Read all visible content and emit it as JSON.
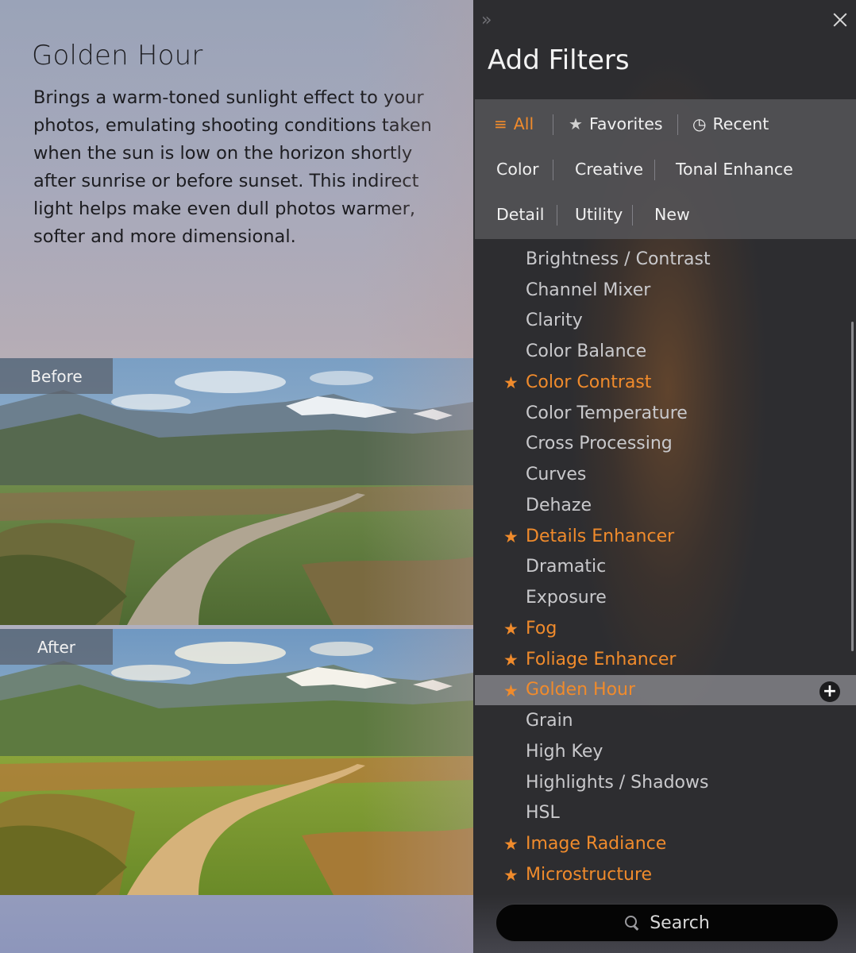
{
  "preview": {
    "title": "Golden Hour",
    "description": "Brings a warm-toned sunlight effect to your photos, emulating shooting conditions taken when the sun is low on the horizon shortly after sunrise or before sunset. This indirect light helps make even dull photos warmer, softer and more dimensional.",
    "before_label": "Before",
    "after_label": "After"
  },
  "panel": {
    "title": "Add Filters",
    "expand_icon": "double-chevron-right-icon",
    "close_icon": "close-icon",
    "categories": {
      "all": "All",
      "favorites": "Favorites",
      "recent": "Recent",
      "color": "Color",
      "creative": "Creative",
      "tonal_enhance": "Tonal Enhance",
      "detail": "Detail",
      "utility": "Utility",
      "new": "New"
    },
    "active_category": "All",
    "filters": [
      {
        "name": "Brightness / Contrast",
        "favorite": false
      },
      {
        "name": "Channel Mixer",
        "favorite": false
      },
      {
        "name": "Clarity",
        "favorite": false
      },
      {
        "name": "Color Balance",
        "favorite": false
      },
      {
        "name": "Color Contrast",
        "favorite": true
      },
      {
        "name": "Color Temperature",
        "favorite": false
      },
      {
        "name": "Cross Processing",
        "favorite": false
      },
      {
        "name": "Curves",
        "favorite": false
      },
      {
        "name": "Dehaze",
        "favorite": false
      },
      {
        "name": "Details Enhancer",
        "favorite": true
      },
      {
        "name": "Dramatic",
        "favorite": false
      },
      {
        "name": "Exposure",
        "favorite": false
      },
      {
        "name": "Fog",
        "favorite": true
      },
      {
        "name": "Foliage Enhancer",
        "favorite": true
      },
      {
        "name": "Golden Hour",
        "favorite": true,
        "selected": true
      },
      {
        "name": "Grain",
        "favorite": false
      },
      {
        "name": "High Key",
        "favorite": false
      },
      {
        "name": "Highlights / Shadows",
        "favorite": false
      },
      {
        "name": "HSL",
        "favorite": false
      },
      {
        "name": "Image Radiance",
        "favorite": true
      },
      {
        "name": "Microstructure",
        "favorite": true
      }
    ],
    "search_label": "Search"
  },
  "colors": {
    "accent": "#f08b2c",
    "panel_bg": "#2d2d30",
    "text_primary": "#f2f2f2",
    "text_secondary": "#c9c9cc"
  }
}
